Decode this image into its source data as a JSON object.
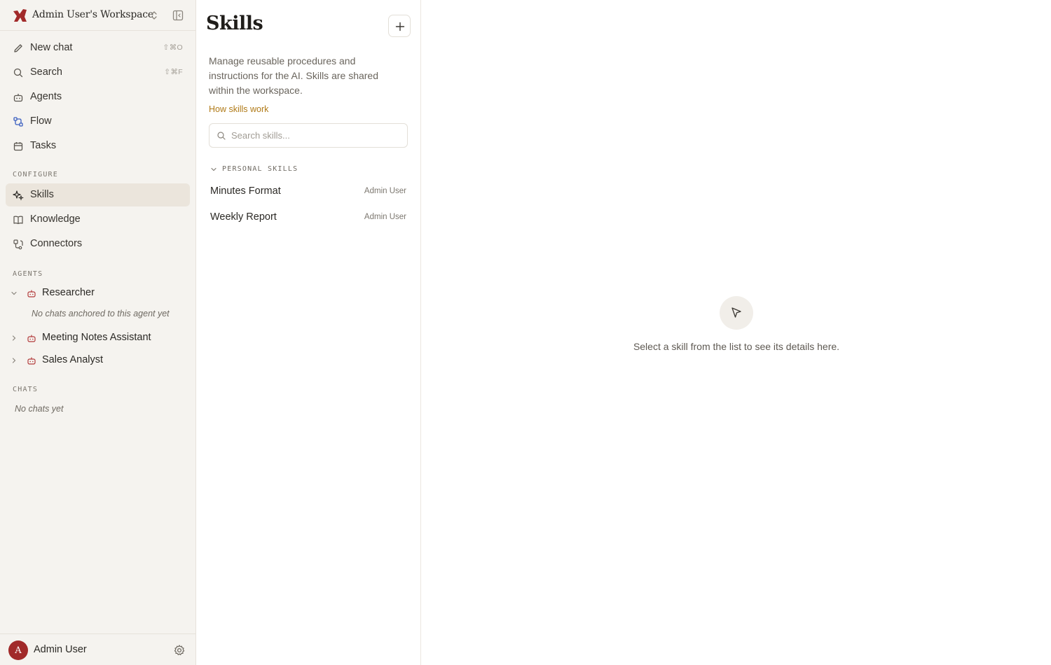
{
  "sidebar": {
    "workspace_name": "Admin User's Workspace",
    "nav": [
      {
        "label": "New chat",
        "shortcut": "⇧⌘O",
        "icon": "pencil-icon"
      },
      {
        "label": "Search",
        "shortcut": "⇧⌘F",
        "icon": "search-icon"
      },
      {
        "label": "Agents",
        "icon": "bot-icon"
      },
      {
        "label": "Flow",
        "icon": "flow-icon"
      },
      {
        "label": "Tasks",
        "icon": "calendar-icon"
      }
    ],
    "configure_label": "CONFIGURE",
    "configure": [
      {
        "label": "Skills",
        "icon": "sparkles-icon",
        "active": true
      },
      {
        "label": "Knowledge",
        "icon": "book-icon"
      },
      {
        "label": "Connectors",
        "icon": "connector-icon"
      }
    ],
    "agents_label": "AGENTS",
    "agents": [
      {
        "label": "Researcher",
        "expanded": true,
        "note": "No chats anchored to this agent yet"
      },
      {
        "label": "Meeting Notes Assistant",
        "expanded": false
      },
      {
        "label": "Sales Analyst",
        "expanded": false
      }
    ],
    "chats_label": "CHATS",
    "chats_empty": "No chats yet",
    "user": {
      "initial": "A",
      "name": "Admin User"
    }
  },
  "skills": {
    "title": "Skills",
    "description": "Manage reusable procedures and instructions for the AI. Skills are shared within the workspace.",
    "how_link": "How skills work",
    "search_placeholder": "Search skills...",
    "group_label": "PERSONAL SKILLS",
    "items": [
      {
        "name": "Minutes Format",
        "owner": "Admin User"
      },
      {
        "name": "Weekly Report",
        "owner": "Admin User"
      }
    ]
  },
  "detail": {
    "empty_text": "Select a skill from the list to see its details here."
  },
  "colors": {
    "accent": "#a12a2a",
    "link": "#b07a17",
    "sidebar_bg": "#f5f3ef",
    "active_bg": "#ebe5dc"
  }
}
